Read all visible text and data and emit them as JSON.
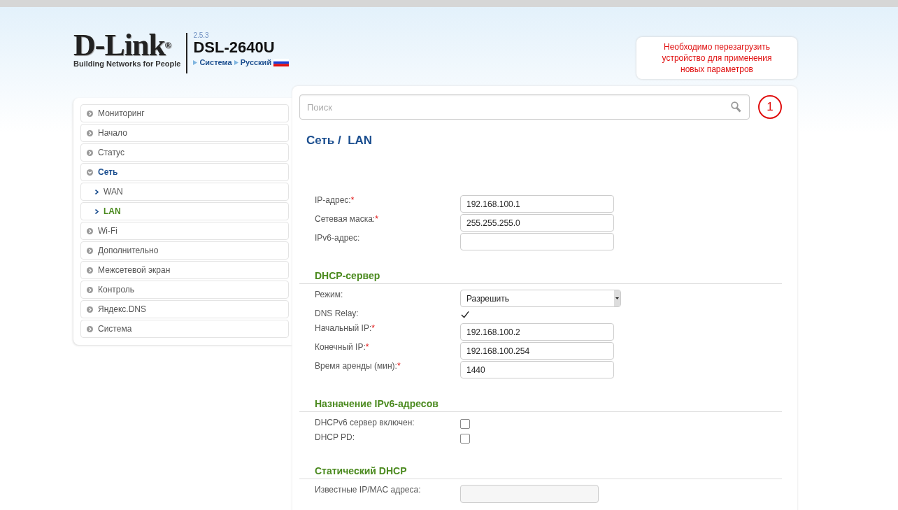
{
  "header": {
    "logo": "D-Link$^{®}$",
    "tagline": "Building Networks for People",
    "version": "2.5.3",
    "model": "DSL-2640U",
    "breadcrumbs": [
      "Система",
      "Русский"
    ]
  },
  "notification": {
    "message": "Необходимо перезагрузить устройство для применения новых параметров",
    "count": "1"
  },
  "search": {
    "placeholder": "Поиск"
  },
  "sidebar": {
    "items": [
      {
        "label": "Мониторинг",
        "expanded": false
      },
      {
        "label": "Начало",
        "expanded": false
      },
      {
        "label": "Статус",
        "expanded": false
      },
      {
        "label": "Сеть",
        "expanded": true,
        "children": [
          {
            "label": "WAN",
            "selected": false
          },
          {
            "label": "LAN",
            "selected": true
          }
        ]
      },
      {
        "label": "Wi-Fi",
        "expanded": false
      },
      {
        "label": "Дополнительно",
        "expanded": false
      },
      {
        "label": "Межсетевой экран",
        "expanded": false
      },
      {
        "label": "Контроль",
        "expanded": false
      },
      {
        "label": "Яндекс.DNS",
        "expanded": false
      },
      {
        "label": "Система",
        "expanded": false
      }
    ]
  },
  "page_title": "Сеть /  LAN",
  "sections": [
    {
      "fields": [
        {
          "kind": "text",
          "label": "IP-адрес:",
          "required_mark": "*",
          "value": "192.168.100.1"
        },
        {
          "kind": "text",
          "label": "Сетевая маска:",
          "required_mark": "*",
          "value": "255.255.255.0"
        },
        {
          "kind": "text",
          "label": "IPv6-адрес:"
        }
      ]
    },
    {
      "title": "DHCP-сервер",
      "fields": [
        {
          "kind": "select",
          "label": "Режим:",
          "value": "Разрешить"
        },
        {
          "kind": "checkbox",
          "label": "DNS Relay:",
          "checked": true
        },
        {
          "kind": "text",
          "label": "Начальный IP:",
          "required_mark": "*",
          "value": "192.168.100.2"
        },
        {
          "kind": "text",
          "label": "Конечный IP:",
          "required_mark": "*",
          "value": "192.168.100.254"
        },
        {
          "kind": "text",
          "label": "Время аренды (мин):",
          "required_mark": "*",
          "value": "1440"
        }
      ]
    },
    {
      "title": "Назначение IPv6-адресов",
      "fields": [
        {
          "kind": "checkbox",
          "label": "DHCPv6 сервер включен:",
          "checked": false
        },
        {
          "kind": "checkbox",
          "label": "DHCP PD:",
          "checked": false
        }
      ]
    },
    {
      "title": "Статический DHCP",
      "fields": [
        {
          "kind": "list",
          "label": "Известные IP/MAC адреса:"
        }
      ]
    }
  ]
}
